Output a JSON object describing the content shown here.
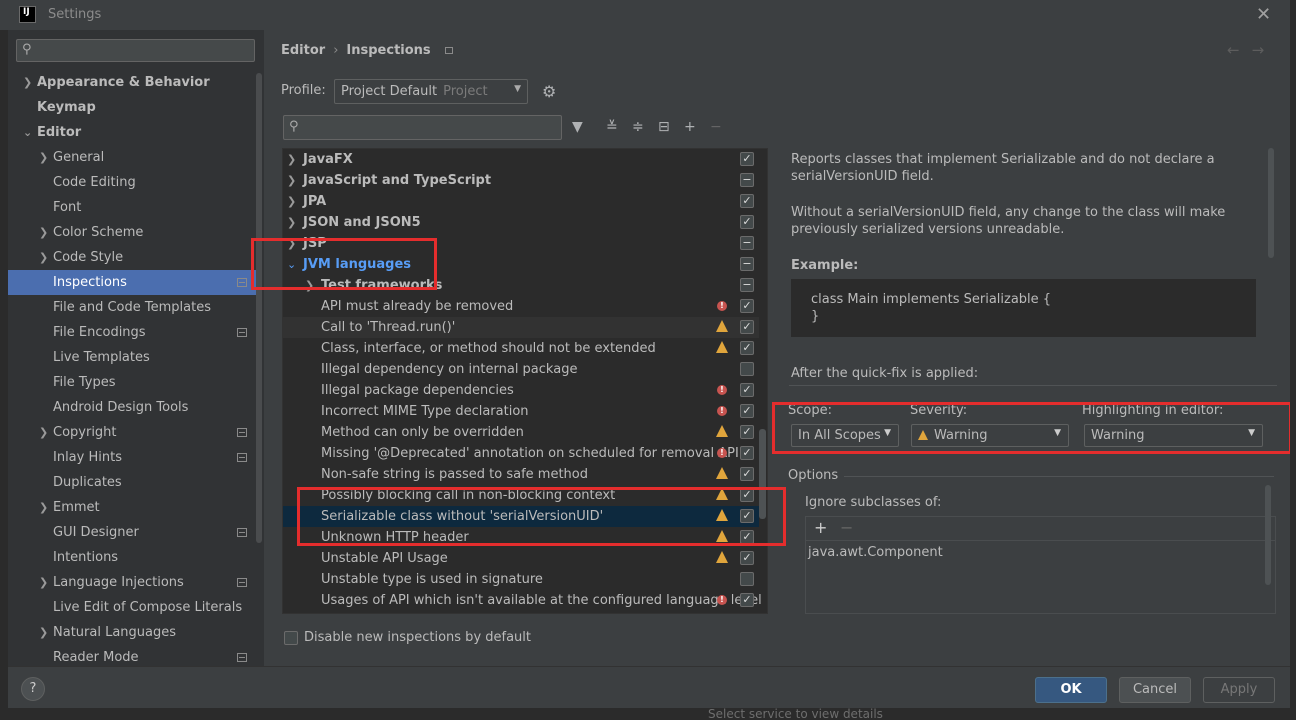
{
  "window": {
    "title": "Settings",
    "app_icon": "IJ"
  },
  "sidebar": {
    "search_placeholder": "",
    "items": [
      {
        "label": "Appearance & Behavior"
      },
      {
        "label": "Keymap"
      },
      {
        "label": "Editor"
      },
      {
        "label": "General"
      },
      {
        "label": "Code Editing"
      },
      {
        "label": "Font"
      },
      {
        "label": "Color Scheme"
      },
      {
        "label": "Code Style"
      },
      {
        "label": "Inspections"
      },
      {
        "label": "File and Code Templates"
      },
      {
        "label": "File Encodings"
      },
      {
        "label": "Live Templates"
      },
      {
        "label": "File Types"
      },
      {
        "label": "Android Design Tools"
      },
      {
        "label": "Copyright"
      },
      {
        "label": "Inlay Hints"
      },
      {
        "label": "Duplicates"
      },
      {
        "label": "Emmet"
      },
      {
        "label": "GUI Designer"
      },
      {
        "label": "Intentions"
      },
      {
        "label": "Language Injections"
      },
      {
        "label": "Live Edit of Compose Literals"
      },
      {
        "label": "Natural Languages"
      },
      {
        "label": "Reader Mode"
      }
    ]
  },
  "breadcrumb": {
    "parent": "Editor",
    "sep": "›",
    "current": "Inspections"
  },
  "profile": {
    "label": "Profile:",
    "value": "Project Default",
    "scope": "Project"
  },
  "inspections": {
    "rows": [
      {
        "label": "JavaFX"
      },
      {
        "label": "JavaScript and TypeScript"
      },
      {
        "label": "JPA"
      },
      {
        "label": "JSON and JSON5"
      },
      {
        "label": "JSP"
      },
      {
        "label": "JVM languages"
      },
      {
        "label": "Test frameworks"
      },
      {
        "label": "API must already be removed"
      },
      {
        "label": "Call to 'Thread.run()'"
      },
      {
        "label": "Class, interface, or method should not be extended"
      },
      {
        "label": "Illegal dependency on internal package"
      },
      {
        "label": "Illegal package dependencies"
      },
      {
        "label": "Incorrect MIME Type declaration"
      },
      {
        "label": "Method can only be overridden"
      },
      {
        "label": "Missing '@Deprecated' annotation on scheduled for removal API"
      },
      {
        "label": "Non-safe string is passed to safe method"
      },
      {
        "label": "Possibly blocking call in non-blocking context"
      },
      {
        "label": "Serializable class without 'serialVersionUID'"
      },
      {
        "label": "Unknown HTTP header"
      },
      {
        "label": "Unstable API Usage"
      },
      {
        "label": "Unstable type is used in signature"
      },
      {
        "label": "Usages of API which isn't available at the configured language level"
      }
    ],
    "disable_new_label": "Disable new inspections by default"
  },
  "description": {
    "p1": "Reports classes that implement Serializable and do not declare a serialVersionUID field.",
    "p2": "Without a serialVersionUID field, any change to the class will make previously serialized versions unreadable.",
    "example_label": "Example:",
    "code_line1": "class Main implements Serializable {",
    "code_line2": "}",
    "after_fix": "After the quick-fix is applied:"
  },
  "settings": {
    "scope_label": "Scope:",
    "scope_value": "In All Scopes",
    "severity_label": "Severity:",
    "severity_value": "Warning",
    "highlight_label": "Highlighting in editor:",
    "highlight_value": "Warning"
  },
  "options": {
    "title": "Options",
    "ignore_label": "Ignore subclasses of:",
    "items": [
      "java.awt.Component"
    ]
  },
  "footer": {
    "help": "?",
    "ok": "OK",
    "cancel": "Cancel",
    "apply": "Apply"
  },
  "background": {
    "status_text": "Select service to view details"
  },
  "colors": {
    "accent": "#4b6eaf",
    "highlight_box": "#e52d2d",
    "warning": "#e0a53c",
    "error": "#c75450"
  }
}
